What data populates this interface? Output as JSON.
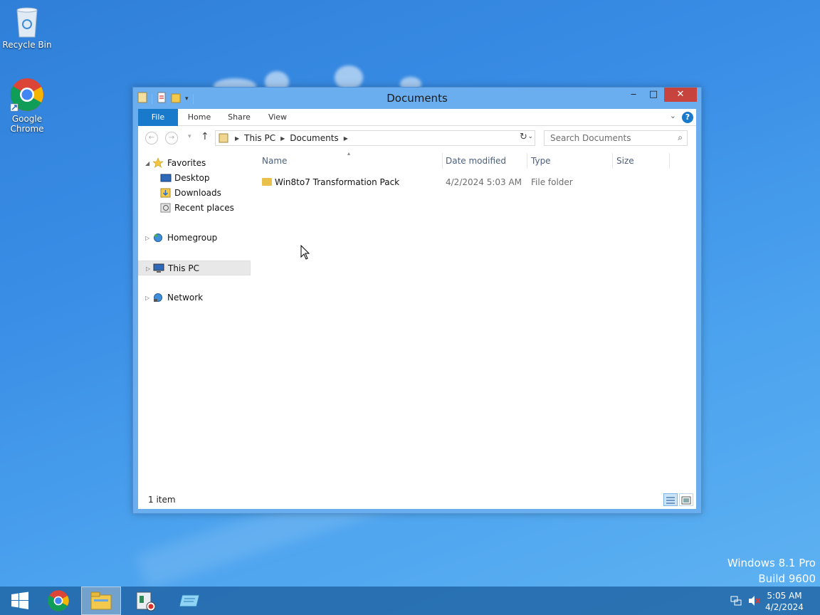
{
  "desktop": {
    "icons": [
      {
        "label": "Recycle Bin",
        "icon": "recycle-bin-icon"
      },
      {
        "label": "Google\nChrome",
        "label_line1": "Google",
        "label_line2": "Chrome",
        "icon": "chrome-icon"
      }
    ],
    "watermark": {
      "line1": "Windows 8.1 Pro",
      "line2": "Build 9600"
    }
  },
  "window": {
    "title": "Documents",
    "controls": {
      "minimize": "‒",
      "maximize": "□",
      "close": "✕"
    },
    "ribbon": {
      "tabs": [
        "File",
        "Home",
        "Share",
        "View"
      ],
      "help": "?"
    },
    "address": {
      "segments": [
        "This PC",
        "Documents"
      ]
    },
    "search": {
      "placeholder": "Search Documents"
    },
    "nav_pane": {
      "favorites": {
        "label": "Favorites",
        "children": [
          "Desktop",
          "Downloads",
          "Recent places"
        ]
      },
      "groups": [
        "Homegroup",
        "This PC",
        "Network"
      ]
    },
    "columns": [
      "Name",
      "Date modified",
      "Type",
      "Size"
    ],
    "items": [
      {
        "name": "Win8to7 Transformation Pack",
        "date": "4/2/2024 5:03 AM",
        "type": "File folder",
        "size": ""
      }
    ],
    "status": {
      "count": "1 item"
    }
  },
  "taskbar": {
    "buttons": [
      "start-button",
      "chrome",
      "file-explorer",
      "app-recorder",
      "app-tool"
    ],
    "clock": {
      "time": "5:05 AM",
      "date": "4/2/2024"
    }
  },
  "colors": {
    "accent": "#1979ca",
    "close": "#c7433d",
    "window_frame": "#6aaef0",
    "desktop": "#3a8ee6"
  }
}
